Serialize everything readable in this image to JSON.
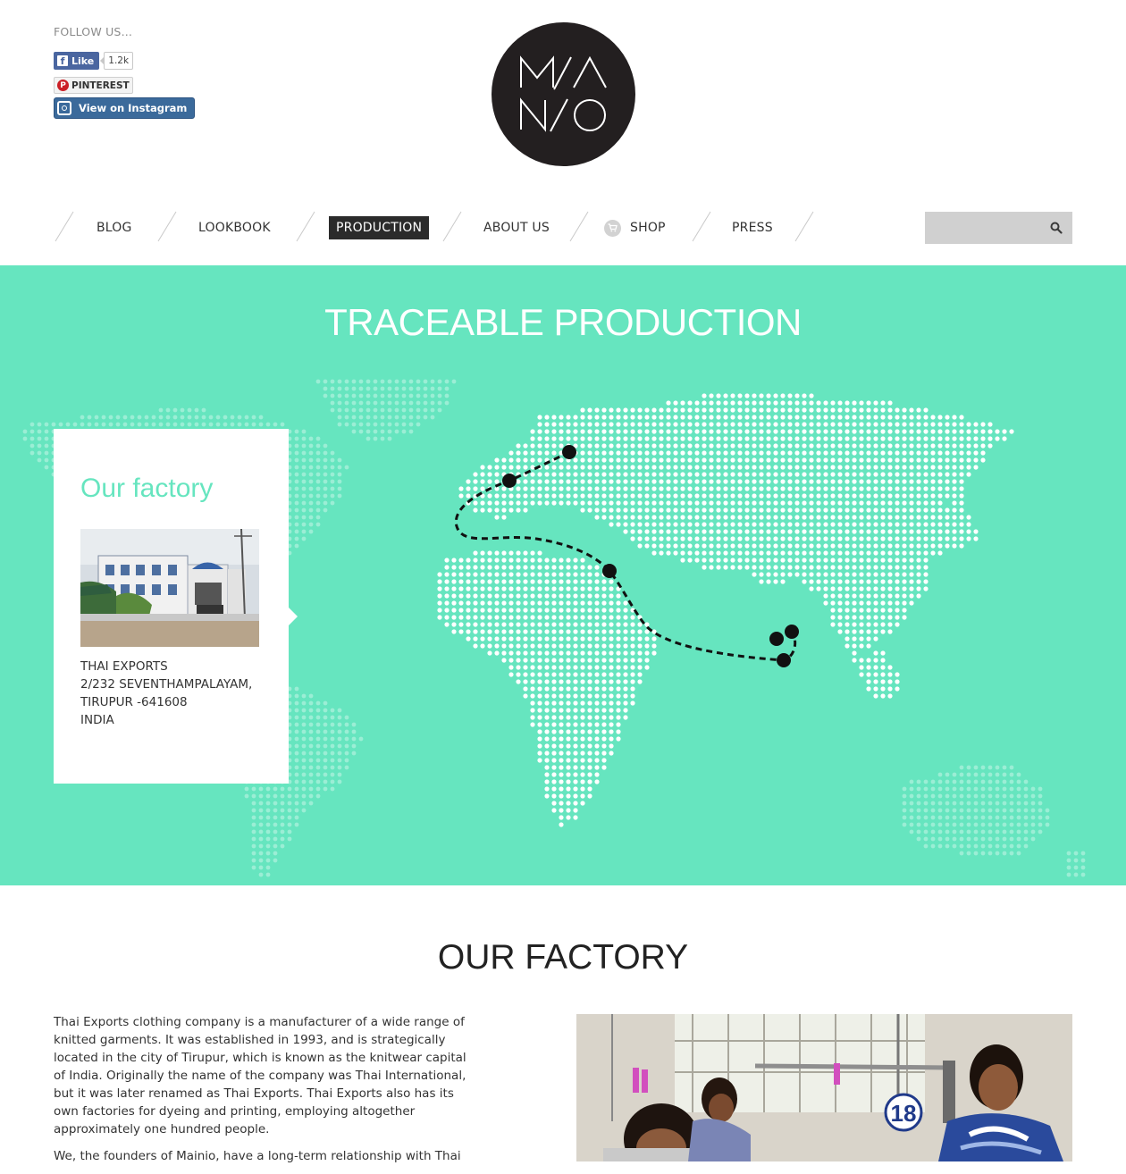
{
  "social": {
    "follow_label": "FOLLOW US...",
    "facebook_like": "Like",
    "facebook_count": "1.2k",
    "pinterest": "PINTEREST",
    "instagram": "View on Instagram"
  },
  "brand": {
    "logo_top": "MA/A",
    "logo_bottom": "N/O"
  },
  "nav": {
    "items": [
      "BLOG",
      "LOOKBOOK",
      "PRODUCTION",
      "ABOUT US",
      "SHOP",
      "PRESS"
    ],
    "active": "PRODUCTION"
  },
  "search": {
    "placeholder": ""
  },
  "map": {
    "title": "TRACEABLE PRODUCTION",
    "card_title": "Our factory",
    "address": [
      "THAI EXPORTS",
      "2/232 SEVENTHAMPALAYAM,",
      "TIRUPUR -641608",
      "INDIA"
    ]
  },
  "factory": {
    "title": "OUR FACTORY",
    "paragraphs": [
      "Thai Exports clothing company is a manufacturer of a wide range of knitted garments. It was established in 1993, and is strategically located in the city of Tirupur, which is known as the knitwear capital of India. Originally the name of the company was Thai International, but it was later renamed as Thai Exports. Thai Exports also has its own factories for dyeing and printing, employing altogether approximately one hundred people.",
      "We, the founders of Mainio, have a long-term relationship with Thai"
    ],
    "machine_number": "18"
  },
  "colors": {
    "accent": "#66e5bf",
    "dark": "#2b2b2b",
    "facebook": "#4a66a0",
    "pinterest": "#cb2027",
    "instagram": "#3b6a9b"
  }
}
